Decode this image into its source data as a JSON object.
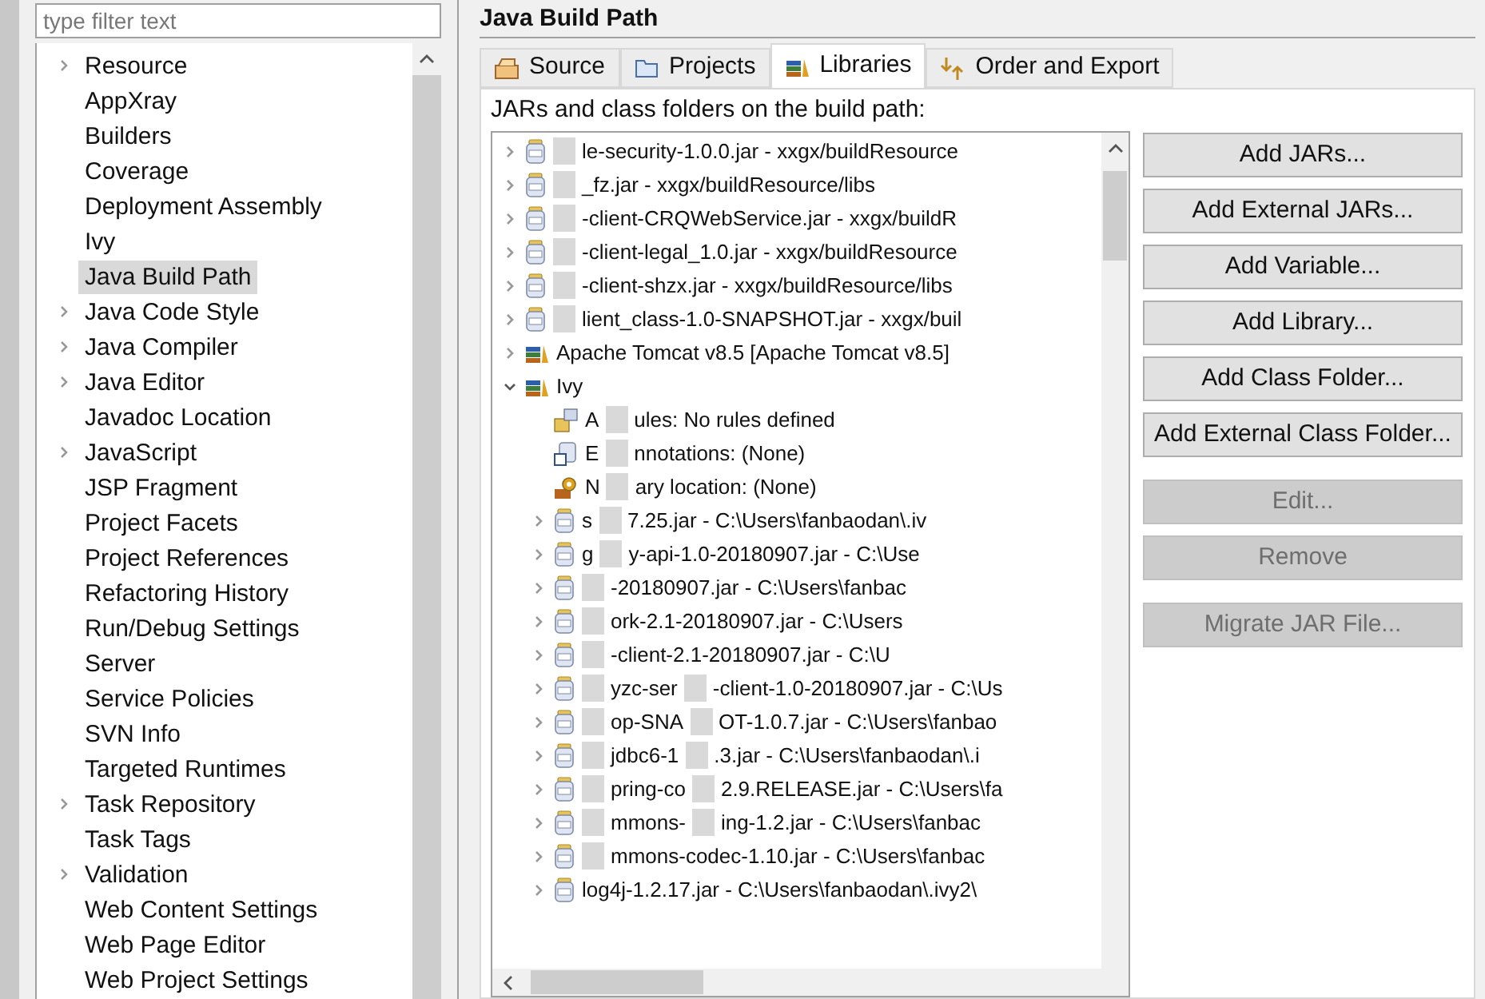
{
  "filter": {
    "placeholder": "type filter text"
  },
  "sidebar": {
    "items": [
      {
        "label": "Resource",
        "expandable": true,
        "selected": false
      },
      {
        "label": "AppXray",
        "expandable": false,
        "selected": false
      },
      {
        "label": "Builders",
        "expandable": false,
        "selected": false
      },
      {
        "label": "Coverage",
        "expandable": false,
        "selected": false
      },
      {
        "label": "Deployment Assembly",
        "expandable": false,
        "selected": false
      },
      {
        "label": "Ivy",
        "expandable": false,
        "selected": false
      },
      {
        "label": "Java Build Path",
        "expandable": false,
        "selected": true
      },
      {
        "label": "Java Code Style",
        "expandable": true,
        "selected": false
      },
      {
        "label": "Java Compiler",
        "expandable": true,
        "selected": false
      },
      {
        "label": "Java Editor",
        "expandable": true,
        "selected": false
      },
      {
        "label": "Javadoc Location",
        "expandable": false,
        "selected": false
      },
      {
        "label": "JavaScript",
        "expandable": true,
        "selected": false
      },
      {
        "label": "JSP Fragment",
        "expandable": false,
        "selected": false
      },
      {
        "label": "Project Facets",
        "expandable": false,
        "selected": false
      },
      {
        "label": "Project References",
        "expandable": false,
        "selected": false
      },
      {
        "label": "Refactoring History",
        "expandable": false,
        "selected": false
      },
      {
        "label": "Run/Debug Settings",
        "expandable": false,
        "selected": false
      },
      {
        "label": "Server",
        "expandable": false,
        "selected": false
      },
      {
        "label": "Service Policies",
        "expandable": false,
        "selected": false
      },
      {
        "label": "SVN Info",
        "expandable": false,
        "selected": false
      },
      {
        "label": "Targeted Runtimes",
        "expandable": false,
        "selected": false
      },
      {
        "label": "Task Repository",
        "expandable": true,
        "selected": false
      },
      {
        "label": "Task Tags",
        "expandable": false,
        "selected": false
      },
      {
        "label": "Validation",
        "expandable": true,
        "selected": false
      },
      {
        "label": "Web Content Settings",
        "expandable": false,
        "selected": false
      },
      {
        "label": "Web Page Editor",
        "expandable": false,
        "selected": false
      },
      {
        "label": "Web Project Settings",
        "expandable": false,
        "selected": false
      }
    ]
  },
  "page": {
    "title": "Java Build Path",
    "tabs": [
      {
        "label": "Source",
        "kind": "source",
        "selected": false
      },
      {
        "label": "Projects",
        "kind": "projects",
        "selected": false
      },
      {
        "label": "Libraries",
        "kind": "libraries",
        "selected": true
      },
      {
        "label": "Order and Export",
        "kind": "order",
        "selected": false
      }
    ],
    "list_label": "JARs and class folders on the build path:",
    "tree": [
      {
        "kind": "jar",
        "masked": true,
        "parts": [
          "le-security-1.0.0.jar - xxgx/buildResource"
        ]
      },
      {
        "kind": "jar",
        "masked": true,
        "parts": [
          "_fz.jar - xxgx/buildResource/libs"
        ]
      },
      {
        "kind": "jar",
        "masked": true,
        "parts": [
          "-client-CRQWebService.jar - xxgx/buildR"
        ]
      },
      {
        "kind": "jar",
        "masked": true,
        "parts": [
          "-client-legal_1.0.jar - xxgx/buildResource"
        ]
      },
      {
        "kind": "jar",
        "masked": true,
        "parts": [
          "-client-shzx.jar - xxgx/buildResource/libs"
        ]
      },
      {
        "kind": "jar",
        "masked": true,
        "parts": [
          "lient_class-1.0-SNAPSHOT.jar - xxgx/buil"
        ]
      },
      {
        "kind": "container",
        "masked": false,
        "expanded": false,
        "parts": [
          "Apache Tomcat v8.5 [Apache Tomcat v8.5]"
        ]
      },
      {
        "kind": "container",
        "masked": false,
        "expanded": true,
        "parts": [
          "Ivy"
        ],
        "children": [
          {
            "kind": "rule",
            "masked": false,
            "parts": [
              "A",
              "ules: No rules defined"
            ]
          },
          {
            "kind": "annotation",
            "masked": false,
            "parts": [
              "E",
              "nnotations: (None)"
            ]
          },
          {
            "kind": "native",
            "masked": false,
            "parts": [
              "N",
              "ary location: (None)"
            ]
          },
          {
            "kind": "jar",
            "masked": false,
            "parts": [
              "s",
              "7.25.jar - C:\\Users\\fanbaodan\\.iv"
            ]
          },
          {
            "kind": "jar",
            "masked": false,
            "parts": [
              "g",
              "y-api-1.0-20180907.jar - C:\\Use"
            ]
          },
          {
            "kind": "jar",
            "masked": true,
            "parts": [
              "-20180907.jar - C:\\Users\\fanbac"
            ]
          },
          {
            "kind": "jar",
            "masked": true,
            "parts": [
              "ork-2.1-20180907.jar - C:\\Users"
            ]
          },
          {
            "kind": "jar",
            "masked": true,
            "parts": [
              "-client-2.1-20180907.jar - C:\\U"
            ]
          },
          {
            "kind": "jar",
            "masked": true,
            "parts": [
              "yzc-ser",
              "-client-1.0-20180907.jar - C:\\Us"
            ]
          },
          {
            "kind": "jar",
            "masked": true,
            "parts": [
              "op-SNA",
              "OT-1.0.7.jar - C:\\Users\\fanbao"
            ]
          },
          {
            "kind": "jar",
            "masked": true,
            "parts": [
              "jdbc6-1",
              ".3.jar - C:\\Users\\fanbaodan\\.i"
            ]
          },
          {
            "kind": "jar",
            "masked": true,
            "parts": [
              "pring-co",
              "2.9.RELEASE.jar - C:\\Users\\fa"
            ]
          },
          {
            "kind": "jar",
            "masked": true,
            "parts": [
              "mmons-",
              "ing-1.2.jar - C:\\Users\\fanbac"
            ]
          },
          {
            "kind": "jar",
            "masked": true,
            "parts": [
              "mmons-codec-1.10.jar - C:\\Users\\fanbac"
            ]
          },
          {
            "kind": "jar",
            "masked": false,
            "parts": [
              "log4j-1.2.17.jar - C:\\Users\\fanbaodan\\.ivy2\\"
            ]
          }
        ]
      }
    ],
    "button_groups": [
      [
        {
          "label": "Add JARs...",
          "disabled": false
        },
        {
          "label": "Add External JARs...",
          "disabled": false
        },
        {
          "label": "Add Variable...",
          "disabled": false
        },
        {
          "label": "Add Library...",
          "disabled": false
        },
        {
          "label": "Add Class Folder...",
          "disabled": false
        },
        {
          "label": "Add External Class Folder...",
          "disabled": false
        }
      ],
      [
        {
          "label": "Edit...",
          "disabled": true
        },
        {
          "label": "Remove",
          "disabled": true
        }
      ],
      [
        {
          "label": "Migrate JAR File...",
          "disabled": true
        }
      ]
    ]
  }
}
